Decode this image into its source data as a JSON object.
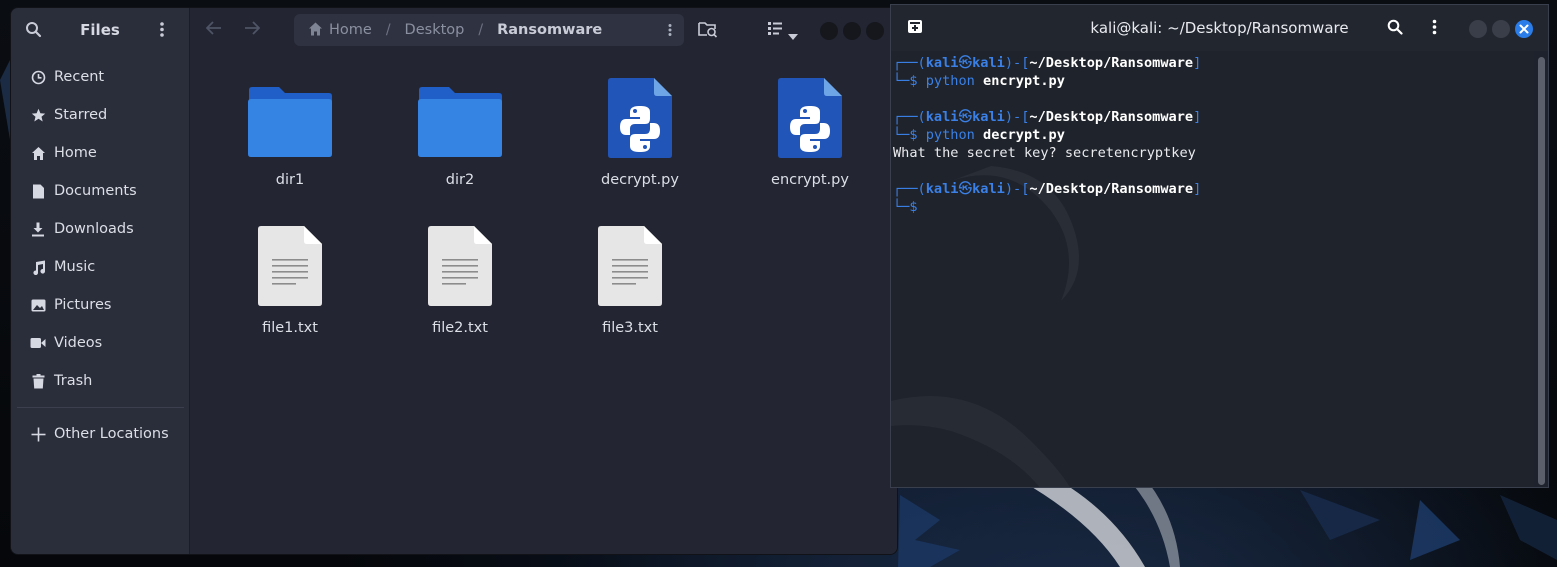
{
  "files": {
    "title": "Files",
    "sidebar": [
      {
        "label": "Recent",
        "icon": "recent-icon"
      },
      {
        "label": "Starred",
        "icon": "star-icon"
      },
      {
        "label": "Home",
        "icon": "home-icon"
      },
      {
        "label": "Documents",
        "icon": "document-icon"
      },
      {
        "label": "Downloads",
        "icon": "download-icon"
      },
      {
        "label": "Music",
        "icon": "music-icon"
      },
      {
        "label": "Pictures",
        "icon": "pictures-icon"
      },
      {
        "label": "Videos",
        "icon": "videos-icon"
      },
      {
        "label": "Trash",
        "icon": "trash-icon"
      }
    ],
    "other_locations": "Other Locations",
    "breadcrumb": [
      "Home",
      "Desktop",
      "Ransomware"
    ],
    "items": [
      {
        "name": "dir1",
        "type": "folder"
      },
      {
        "name": "dir2",
        "type": "folder"
      },
      {
        "name": "decrypt.py",
        "type": "python"
      },
      {
        "name": "encrypt.py",
        "type": "python"
      },
      {
        "name": "file1.txt",
        "type": "text"
      },
      {
        "name": "file2.txt",
        "type": "text"
      },
      {
        "name": "file3.txt",
        "type": "text"
      }
    ]
  },
  "terminal": {
    "title": "kali@kali: ~/Desktop/Ransomware",
    "user": "kali",
    "host": "kali",
    "cwd": "~/Desktop/Ransomware",
    "lines": [
      {
        "cmd": "python",
        "arg": "encrypt.py",
        "output": ""
      },
      {
        "cmd": "python",
        "arg": "decrypt.py",
        "output": "What the secret key? secretencryptkey"
      }
    ]
  },
  "colors": {
    "accent": "#3584e4",
    "prompt_blue": "#3a80e6"
  }
}
